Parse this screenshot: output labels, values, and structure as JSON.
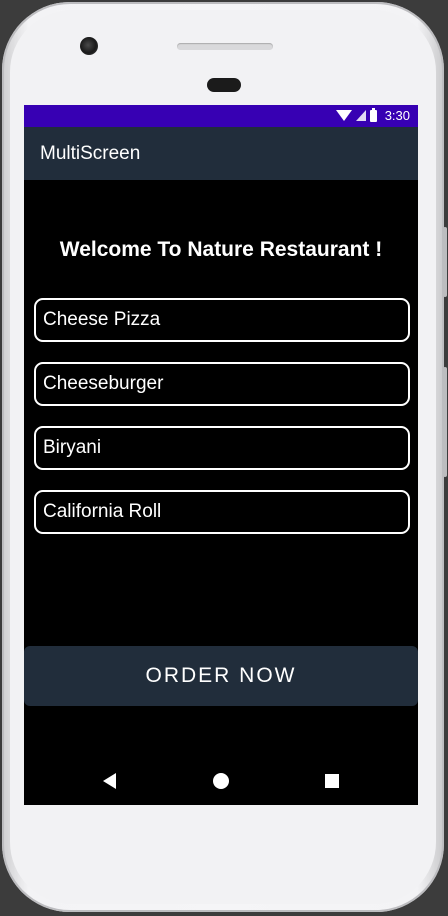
{
  "status_bar": {
    "time": "3:30",
    "icons": [
      "wifi-icon",
      "signal-icon",
      "battery-icon"
    ]
  },
  "app_bar": {
    "title": "MultiScreen"
  },
  "main": {
    "heading": "Welcome To Nature Restaurant !",
    "menu_items": [
      {
        "label": "Cheese Pizza"
      },
      {
        "label": "Cheeseburger"
      },
      {
        "label": "Biryani"
      },
      {
        "label": "California Roll"
      }
    ],
    "order_button": "ORDER NOW"
  },
  "nav_bar": {
    "icons": [
      "back-icon",
      "home-icon",
      "recents-icon"
    ]
  },
  "colors": {
    "status_bar": "#3700b3",
    "app_bar": "#212d3b",
    "background": "#000000",
    "text": "#ffffff"
  }
}
